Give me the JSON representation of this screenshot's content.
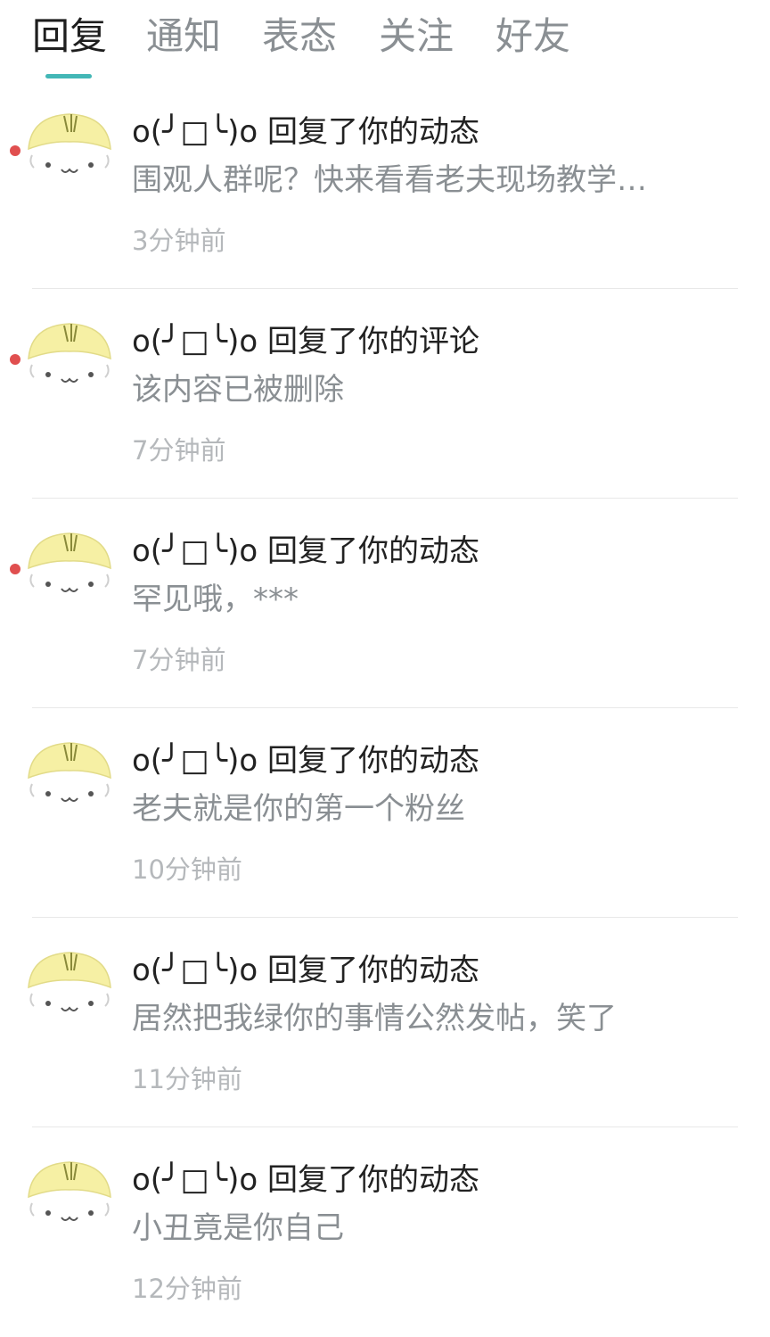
{
  "tabs": [
    {
      "label": "回复",
      "active": true
    },
    {
      "label": "通知",
      "active": false
    },
    {
      "label": "表态",
      "active": false
    },
    {
      "label": "关注",
      "active": false
    },
    {
      "label": "好友",
      "active": false
    }
  ],
  "accent_color": "#43b7b6",
  "unread_dot_color": "#e04f4f",
  "notifications": [
    {
      "title": "o(╯□╰)o 回复了你的动态",
      "content": "围观人群呢？快来看看老夫现场教学…",
      "time": "3分钟前",
      "unread": true,
      "avatar_icon": "cartoon-face-avatar-icon"
    },
    {
      "title": "o(╯□╰)o 回复了你的评论",
      "content": "该内容已被删除",
      "time": "7分钟前",
      "unread": true,
      "avatar_icon": "cartoon-face-avatar-icon"
    },
    {
      "title": "o(╯□╰)o 回复了你的动态",
      "content": "罕见哦，***",
      "time": "7分钟前",
      "unread": true,
      "avatar_icon": "cartoon-face-avatar-icon"
    },
    {
      "title": "o(╯□╰)o 回复了你的动态",
      "content": "老夫就是你的第一个粉丝",
      "time": "10分钟前",
      "unread": false,
      "avatar_icon": "cartoon-face-avatar-icon"
    },
    {
      "title": "o(╯□╰)o 回复了你的动态",
      "content": "居然把我绿你的事情公然发帖，笑了",
      "time": "11分钟前",
      "unread": false,
      "avatar_icon": "cartoon-face-avatar-icon"
    },
    {
      "title": "o(╯□╰)o 回复了你的动态",
      "content": "小丑竟是你自己",
      "time": "12分钟前",
      "unread": false,
      "avatar_icon": "cartoon-face-avatar-icon"
    }
  ]
}
